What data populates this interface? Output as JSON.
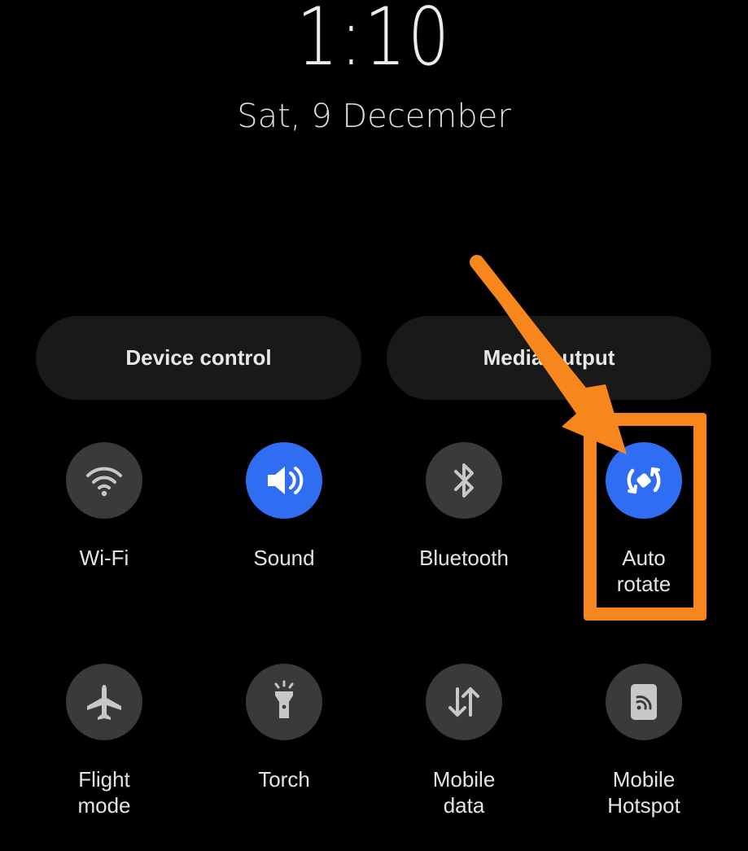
{
  "lockscreen": {
    "time": "1:10",
    "date": "Sat, 9 December"
  },
  "panel_buttons": {
    "device_control": "Device control",
    "media_output": "Media output"
  },
  "quick_tiles": [
    {
      "label": "Wi-Fi",
      "icon": "wifi-icon",
      "active": false
    },
    {
      "label": "Sound",
      "icon": "sound-icon",
      "active": true
    },
    {
      "label": "Bluetooth",
      "icon": "bluetooth-icon",
      "active": false
    },
    {
      "label": "Auto\nrotate",
      "icon": "auto-rotate-icon",
      "active": true
    },
    {
      "label": "Flight\nmode",
      "icon": "airplane-icon",
      "active": false
    },
    {
      "label": "Torch",
      "icon": "torch-icon",
      "active": false
    },
    {
      "label": "Mobile\ndata",
      "icon": "mobile-data-icon",
      "active": false
    },
    {
      "label": "Mobile\nHotspot",
      "icon": "hotspot-icon",
      "active": false
    }
  ],
  "colors": {
    "background": "#000000",
    "tile_inactive": "#3a3a3a",
    "tile_active": "#2f6df2",
    "annotation_orange": "#f7871c"
  }
}
